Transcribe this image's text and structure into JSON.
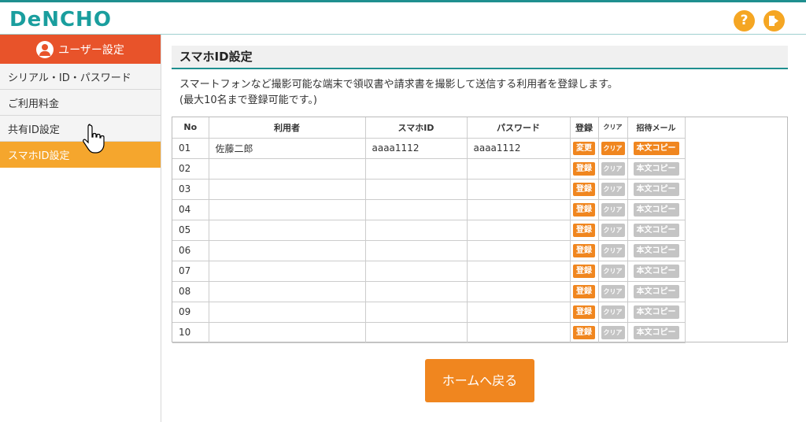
{
  "header": {
    "logo": "DeNCHO",
    "help_icon": "question-mark-icon",
    "logout_icon": "logout-icon",
    "help_glyph": "?"
  },
  "sidebar": {
    "header_label": "ユーザー設定",
    "items": [
      {
        "label": "シリアル・ID・パスワード"
      },
      {
        "label": "ご利用料金"
      },
      {
        "label": "共有ID設定"
      },
      {
        "label": "スマホID設定"
      }
    ],
    "active_index": 3
  },
  "main": {
    "title": "スマホID設定",
    "description_line1": "スマートフォンなど撮影可能な端末で領収書や請求書を撮影して送信する利用者を登録します。",
    "description_line2": "(最大10名まで登録可能です。)",
    "table": {
      "headers": [
        "No",
        "利用者",
        "スマホID",
        "パスワード",
        "登録",
        "クリア",
        "招待メール"
      ],
      "rows": [
        {
          "no": "01",
          "user": "佐藤二郎",
          "id": "aaaa1112",
          "password": "aaaa1112",
          "register": "変更",
          "clear": "クリア",
          "mail": "本文コピー",
          "active": true
        },
        {
          "no": "02",
          "user": "",
          "id": "",
          "password": "",
          "register": "登録",
          "clear": "クリア",
          "mail": "本文コピー",
          "active": false
        },
        {
          "no": "03",
          "user": "",
          "id": "",
          "password": "",
          "register": "登録",
          "clear": "クリア",
          "mail": "本文コピー",
          "active": false
        },
        {
          "no": "04",
          "user": "",
          "id": "",
          "password": "",
          "register": "登録",
          "clear": "クリア",
          "mail": "本文コピー",
          "active": false
        },
        {
          "no": "05",
          "user": "",
          "id": "",
          "password": "",
          "register": "登録",
          "clear": "クリア",
          "mail": "本文コピー",
          "active": false
        },
        {
          "no": "06",
          "user": "",
          "id": "",
          "password": "",
          "register": "登録",
          "clear": "クリア",
          "mail": "本文コピー",
          "active": false
        },
        {
          "no": "07",
          "user": "",
          "id": "",
          "password": "",
          "register": "登録",
          "clear": "クリア",
          "mail": "本文コピー",
          "active": false
        },
        {
          "no": "08",
          "user": "",
          "id": "",
          "password": "",
          "register": "登録",
          "clear": "クリア",
          "mail": "本文コピー",
          "active": false
        },
        {
          "no": "09",
          "user": "",
          "id": "",
          "password": "",
          "register": "登録",
          "clear": "クリア",
          "mail": "本文コピー",
          "active": false
        },
        {
          "no": "10",
          "user": "",
          "id": "",
          "password": "",
          "register": "登録",
          "clear": "クリア",
          "mail": "本文コピー",
          "active": false
        }
      ]
    },
    "home_button": "ホームへ戻る"
  },
  "colors": {
    "brand_teal": "#1a9e9e",
    "accent_orange": "#f0861f",
    "sidebar_header_red": "#e8532a",
    "active_item": "#f5a62d",
    "disabled_gray": "#c4c4c4"
  }
}
